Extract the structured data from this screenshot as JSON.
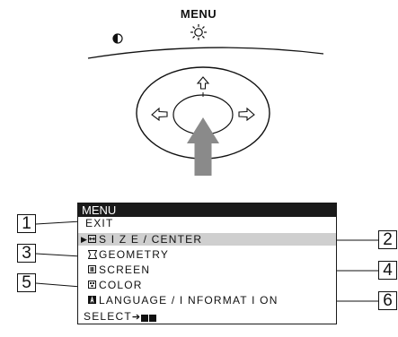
{
  "control_panel": {
    "menu_label": "MENU",
    "icons": [
      "contrast-icon",
      "brightness-icon",
      "arrow-up-icon",
      "arrow-left-icon",
      "arrow-right-icon",
      "press-arrow-icon"
    ]
  },
  "osd": {
    "title": "MENU",
    "items": [
      {
        "label": "EXIT",
        "icon": "none"
      },
      {
        "label": "S I Z E / CENTER",
        "icon": "size-center-icon",
        "selected": true
      },
      {
        "label": "GEOMETRY",
        "icon": "geometry-icon"
      },
      {
        "label": "SCREEN",
        "icon": "screen-icon"
      },
      {
        "label": "COLOR",
        "icon": "color-icon"
      },
      {
        "label": "LANGUAGE / I NFORMAT I ON",
        "icon": "language-icon"
      }
    ],
    "footer": "SELECT"
  },
  "callouts": [
    "1",
    "2",
    "3",
    "4",
    "5",
    "6"
  ]
}
